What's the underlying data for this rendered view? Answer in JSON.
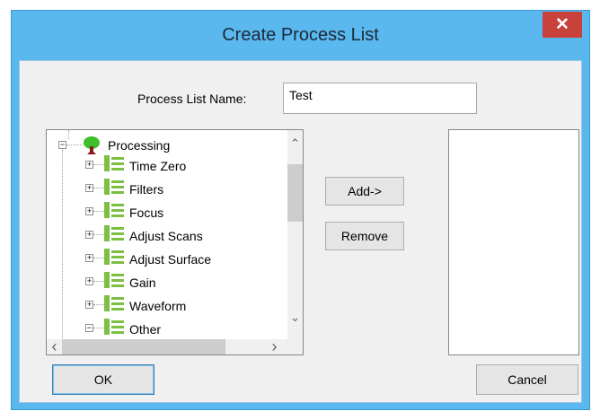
{
  "window": {
    "title": "Create Process List",
    "close_glyph": "✕"
  },
  "form": {
    "name_label": "Process List Name:",
    "name_value": "Test"
  },
  "tree": {
    "root": "Processing",
    "items": [
      "Time Zero",
      "Filters",
      "Focus",
      "Adjust Scans",
      "Adjust Surface",
      "Gain",
      "Waveform",
      "Other"
    ],
    "expand_glyph": "+",
    "collapse_glyph": "−"
  },
  "buttons": {
    "add": "Add->",
    "remove": "Remove",
    "ok": "OK",
    "cancel": "Cancel"
  },
  "scroll": {
    "up": "⌃",
    "down": "⌄",
    "left": "‹",
    "right": "›"
  },
  "icons": {
    "root_icon": "tree-root-icon",
    "item_icon": "tree-node-icon"
  },
  "colors": {
    "titlebar": "#5ab8ee",
    "close_button": "#c8423b",
    "tree_icon_green": "#7cc043"
  }
}
